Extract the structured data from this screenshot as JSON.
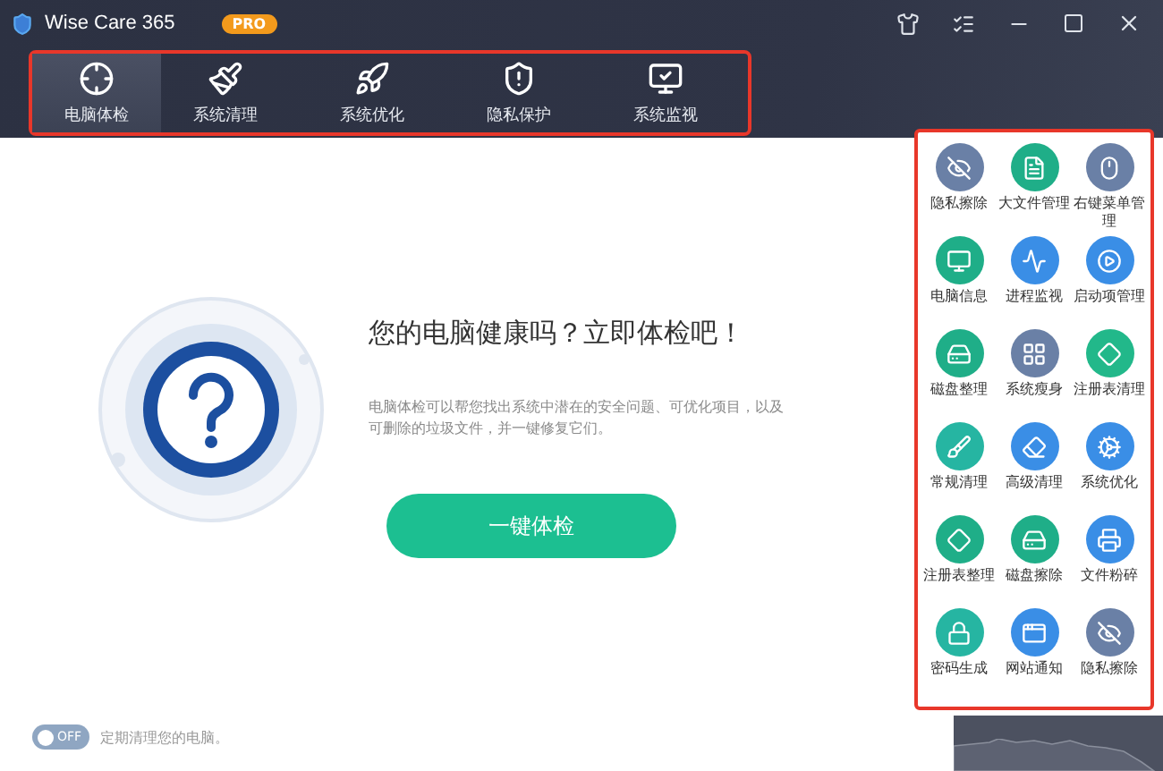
{
  "window": {
    "title": "Wise Care 365",
    "badge": "PRO"
  },
  "tabs": [
    {
      "label": "电脑体检",
      "selected": true
    },
    {
      "label": "系统清理",
      "selected": false
    },
    {
      "label": "系统优化",
      "selected": false
    },
    {
      "label": "隐私保护",
      "selected": false
    },
    {
      "label": "系统监视",
      "selected": false
    }
  ],
  "headline": "您的电脑健康吗？立即体检吧！",
  "description": "电脑体检可以帮您找出系统中潜在的安全问题、可优化项目，以及可删除的垃圾文件，并一键修复它们。",
  "scan_button": "一键体检",
  "schedule": {
    "toggle": {
      "on": false,
      "label": "OFF"
    },
    "text": "定期清理您的电脑。"
  },
  "tools": [
    {
      "label": "隐私擦除",
      "color": "#6a80a6"
    },
    {
      "label": "大文件管理",
      "color": "#1fae88"
    },
    {
      "label": "右键菜单管理",
      "color": "#6a80a6"
    },
    {
      "label": "电脑信息",
      "color": "#1fae88"
    },
    {
      "label": "进程监视",
      "color": "#3a8ee6"
    },
    {
      "label": "启动项管理",
      "color": "#3a8ee6"
    },
    {
      "label": "磁盘整理",
      "color": "#1fae88"
    },
    {
      "label": "系统瘦身",
      "color": "#6a80a6"
    },
    {
      "label": "注册表清理",
      "color": "#22b88a"
    },
    {
      "label": "常规清理",
      "color": "#26b5a2"
    },
    {
      "label": "高级清理",
      "color": "#3a8ee6"
    },
    {
      "label": "系统优化",
      "color": "#3a8ee6"
    },
    {
      "label": "注册表整理",
      "color": "#1fae88"
    },
    {
      "label": "磁盘擦除",
      "color": "#1fae88"
    },
    {
      "label": "文件粉碎",
      "color": "#3a8ee6"
    },
    {
      "label": "密码生成",
      "color": "#26b5a2"
    },
    {
      "label": "网站通知",
      "color": "#3a8ee6"
    },
    {
      "label": "隐私擦除",
      "color": "#6a80a6"
    }
  ]
}
